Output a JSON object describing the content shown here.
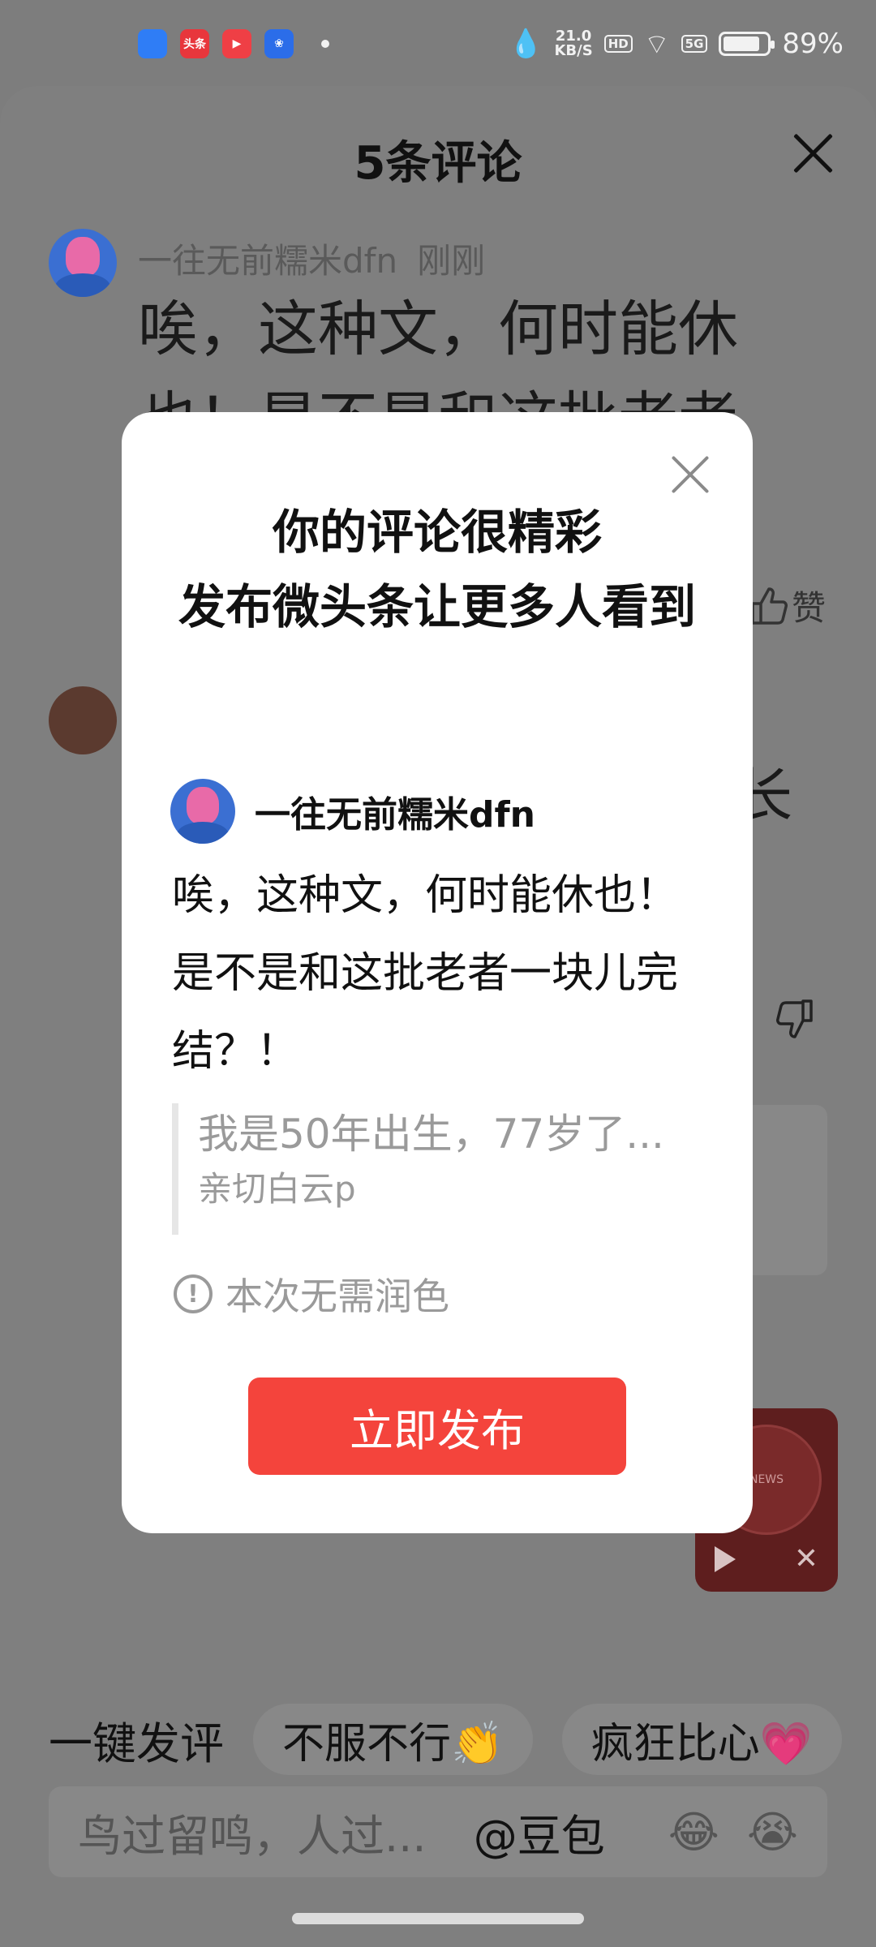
{
  "status_bar": {
    "apps": [
      "app-blue",
      "头条",
      "play",
      "baidu"
    ],
    "net_speed_value": "21.0",
    "net_speed_unit": "KB/S",
    "hd": "HD",
    "signal": "5G",
    "battery": "89%"
  },
  "sheet": {
    "title": "5条评论",
    "comment1": {
      "author": "一往无前糯米dfn",
      "time": "刚刚",
      "text": "唉，这种文，何时能休也！是不是和这批老者"
    },
    "like_label": "赞",
    "fragment": "长"
  },
  "modal": {
    "heading_line1": "你的评论很精彩",
    "heading_line2": "发布微头条让更多人看到",
    "author": "一往无前糯米dfn",
    "text": "唉，这种文，何时能休也！是不是和这批老者一块儿完结？！",
    "quote_text": "我是50年出生，77岁了...",
    "quote_author": "亲切白云p",
    "notice": "本次无需润色",
    "publish_button": "立即发布"
  },
  "float_player": {
    "label": "NEWS"
  },
  "quick_bar": {
    "label": "一键发评",
    "chips": [
      "不服不行👏",
      "疯狂比心💗"
    ]
  },
  "input_bar": {
    "placeholder": "鸟过留鸣，人过...",
    "mention": "@豆包",
    "emoji1": "😂",
    "emoji2": "😭"
  },
  "colors": {
    "accent": "#f4443c",
    "overlay": "#7f7f7f"
  }
}
